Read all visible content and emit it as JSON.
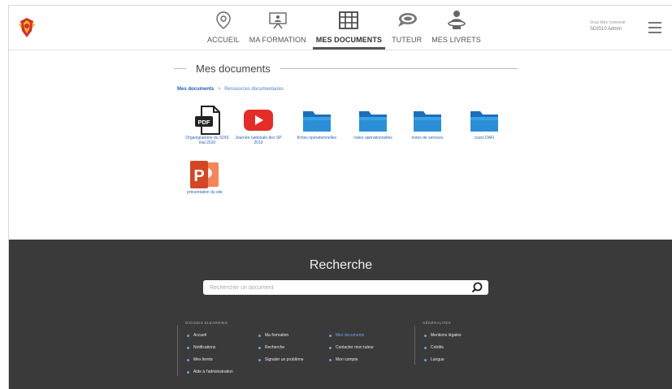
{
  "header": {
    "nav": [
      {
        "label": "ACCUEIL",
        "icon": "map-pin-icon",
        "active": false
      },
      {
        "label": "MA FORMATION",
        "icon": "presentation-board-icon",
        "active": false
      },
      {
        "label": "MES DOCUMENTS",
        "icon": "documents-grid-icon",
        "active": true
      },
      {
        "label": "TUTEUR",
        "icon": "chat-bubbles-icon",
        "active": false
      },
      {
        "label": "MES LIVRETS",
        "icon": "person-desk-icon",
        "active": false
      }
    ],
    "user_welcome": "Vous êtes connecté",
    "user_name": "SDIS10 Admin"
  },
  "content": {
    "title": "Mes documents",
    "breadcrumb": {
      "current": "Mes documents",
      "separator": ">",
      "link": "Ressources documentaires"
    },
    "documents": [
      {
        "label": "Organigramme du SDIS mai 2020",
        "type": "pdf-file-icon"
      },
      {
        "label": "Journée nationale des SP 2019",
        "type": "youtube-video-icon"
      },
      {
        "label": "fiches opérationnelles",
        "type": "folder-icon"
      },
      {
        "label": "notes opérationnelles",
        "type": "folder-icon"
      },
      {
        "label": "notes de services",
        "type": "folder-icon"
      },
      {
        "label": "cours DAFI",
        "type": "folder-icon"
      },
      {
        "label": "présentation du site",
        "type": "powerpoint-file-icon"
      }
    ]
  },
  "footer": {
    "search_title": "Recherche",
    "search_placeholder": "Rechercher un document",
    "col1_title": "DIGISDIS ELEARNING",
    "col1_links": [
      "Accueil",
      "Notifications",
      "Mes livrets",
      "Aide à l'administration",
      "Ma formation",
      "Recherche",
      "Signaler un problème",
      "Mes documents",
      "Contacter mon tuteur",
      "Mon compte"
    ],
    "col2_title": "GÉNÉRALITÉS",
    "col2_links": [
      "Mentions légales",
      "Crédits",
      "Langue"
    ],
    "colors": {
      "background": "#3a3a3a",
      "link": "#e8e8e8",
      "accent": "#6aa0e6"
    }
  }
}
